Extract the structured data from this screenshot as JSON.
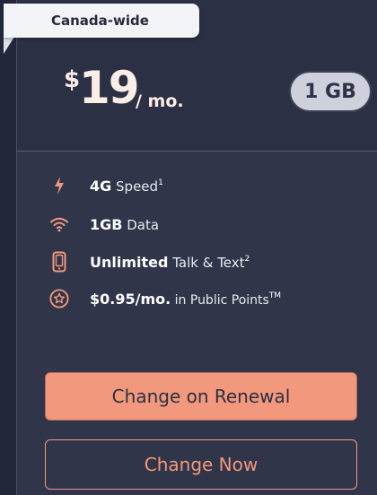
{
  "plan": {
    "tag": "Canada-wide",
    "price_currency": "$",
    "price_amount": "19",
    "price_period": "/ mo.",
    "data_badge": "1 GB"
  },
  "features": [
    {
      "icon": "lightning-bolt-icon",
      "strong": "4G",
      "rest": " Speed",
      "sup": "1"
    },
    {
      "icon": "wifi-signal-icon",
      "strong": "1GB",
      "rest": " Data",
      "sup": ""
    },
    {
      "icon": "mobile-phone-icon",
      "strong": "Unlimited",
      "rest": " Talk & Text",
      "sup": "2"
    },
    {
      "icon": "star-badge-icon",
      "strong": "$0.95/mo.",
      "rest": " in Public Points",
      "sup": "TM"
    }
  ],
  "buttons": {
    "change_on_renewal": "Change on Renewal",
    "change_now": "Change Now"
  },
  "colors": {
    "accent": "#f2997d",
    "background": "#262a3d",
    "card": "#303549",
    "badge": "#ced1dc"
  }
}
